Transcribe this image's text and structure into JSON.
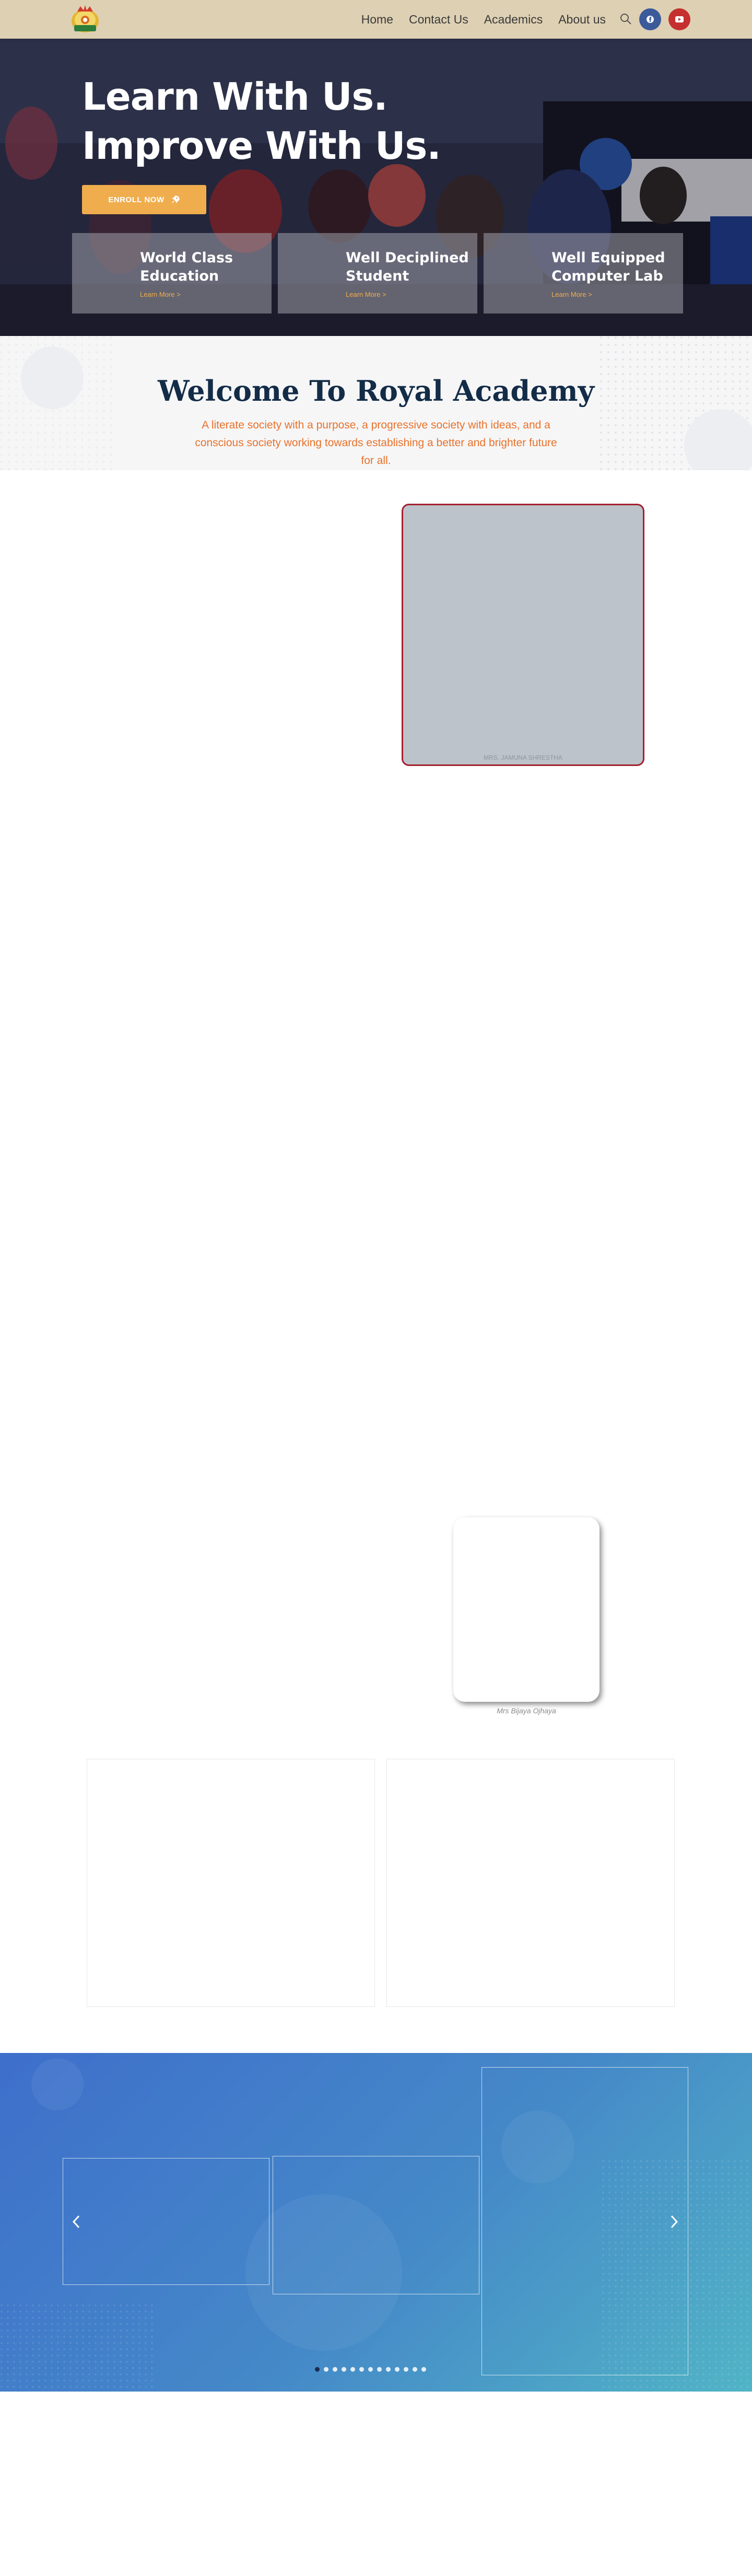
{
  "nav": {
    "logo_name": "royal-academy-logo",
    "links": [
      "Home",
      "Contact Us",
      "Academics",
      "About us"
    ],
    "search_icon": "search-icon",
    "social": [
      {
        "name": "facebook-icon",
        "color": "#3b5a9a"
      },
      {
        "name": "youtube-icon",
        "color": "#c62f2f"
      }
    ]
  },
  "hero": {
    "title_line1": "Learn With Us.",
    "title_line2": "Improve With Us.",
    "enroll_label": "ENROLL NOW",
    "enroll_icon": "rocket-icon",
    "accent": "#f0ad4e",
    "features": [
      {
        "title": "World Class Education",
        "link": "Learn More >"
      },
      {
        "title": "Well Deciplined Student",
        "link": "Learn More >"
      },
      {
        "title": "Well Equipped Computer Lab",
        "link": "Learn More >"
      }
    ]
  },
  "welcome": {
    "title": "Welcome To Royal Academy",
    "subtitle": "A literate society with a purpose, a progressive society with ideas, and a conscious society working towards establishing a better and brighter future for all.",
    "title_color": "#132c47",
    "subtitle_color": "#e8722b"
  },
  "photo": {
    "caption": "MRS. JAMUNA SHRESTHA",
    "border_color": "#a3212f"
  },
  "profile": {
    "caption": "Mrs Bijaya Ojhaya"
  },
  "carousel": {
    "prev_icon": "chevron-left-icon",
    "next_icon": "chevron-right-icon",
    "dot_count": 13,
    "active_dot": 1
  }
}
